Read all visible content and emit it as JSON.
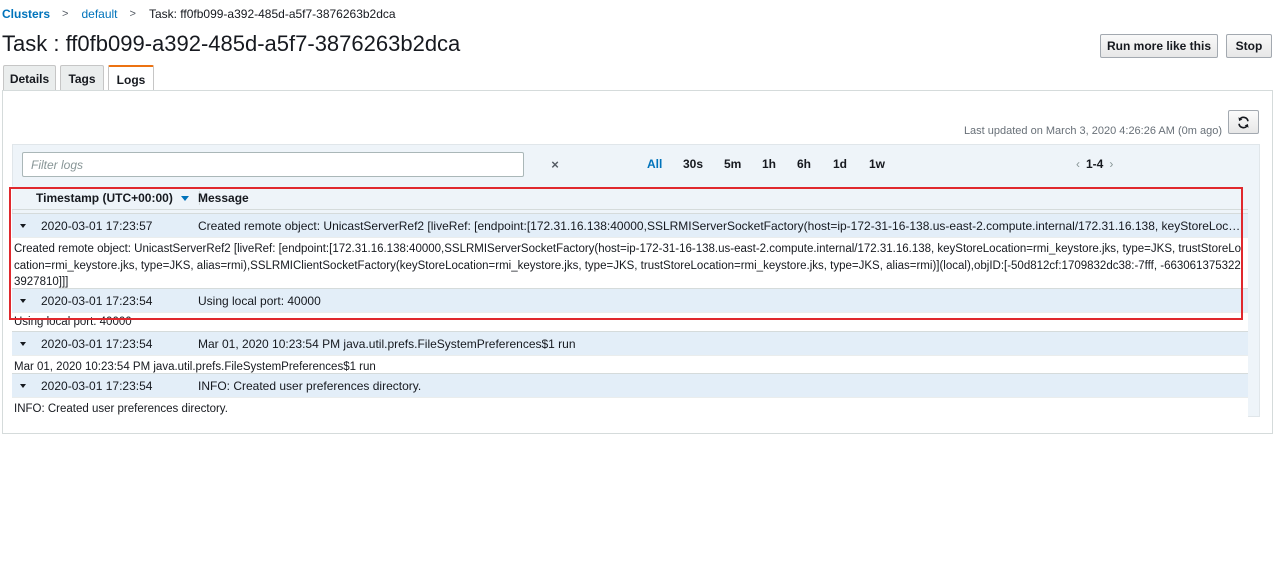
{
  "breadcrumb": {
    "items": [
      "Clusters",
      "default"
    ],
    "current": "Task: ff0fb099-a392-485d-a5f7-3876263b2dca",
    "separator": ">"
  },
  "page": {
    "title": "Task : ff0fb099-a392-485d-a5f7-3876263b2dca"
  },
  "header_buttons": {
    "run_more": "Run more like this",
    "stop": "Stop"
  },
  "tabs": [
    {
      "label": "Details",
      "active": false
    },
    {
      "label": "Tags",
      "active": false
    },
    {
      "label": "Logs",
      "active": true
    }
  ],
  "logs": {
    "last_updated": "Last updated on March 3, 2020 4:26:26 AM (0m ago)",
    "refresh_icon": "refresh-icon",
    "filter_placeholder": "Filter logs",
    "filter_value": "",
    "clear_icon": "×",
    "time_ranges": [
      "All",
      "30s",
      "5m",
      "1h",
      "6h",
      "1d",
      "1w"
    ],
    "active_range": "All",
    "pagination": {
      "text": "1-4",
      "prev": "‹",
      "next": "›"
    },
    "columns": {
      "timestamp": "Timestamp (UTC+00:00)",
      "message": "Message"
    },
    "rows": [
      {
        "timestamp": "2020-03-01 17:23:57",
        "message": "Created remote object: UnicastServerRef2 [liveRef: [endpoint:[172.31.16.138:40000,SSLRMIServerSocketFactory(host=ip-172-31-16-138.us-east-2.compute.internal/172.31.16.138, keyStoreLocation=rmi_keystore.jks, type=JKS,",
        "detail": "Created remote object: UnicastServerRef2 [liveRef: [endpoint:[172.31.16.138:40000,SSLRMIServerSocketFactory(host=ip-172-31-16-138.us-east-2.compute.internal/172.31.16.138, keyStoreLocation=rmi_keystore.jks, type=JKS, trustStoreLocation=rmi_keystore.jks, type=JKS, alias=rmi),SSLRMIClientSocketFactory(keyStoreLocation=rmi_keystore.jks, type=JKS, trustStoreLocation=rmi_keystore.jks, type=JKS, alias=rmi)](local),objID:[-50d812cf:1709832dc38:-7fff, -6630613753223927810]]]"
      },
      {
        "timestamp": "2020-03-01 17:23:54",
        "message": "Using local port: 40000",
        "detail": "Using local port: 40000"
      },
      {
        "timestamp": "2020-03-01 17:23:54",
        "message": "Mar 01, 2020 10:23:54 PM java.util.prefs.FileSystemPreferences$1 run",
        "detail": "Mar 01, 2020 10:23:54 PM java.util.prefs.FileSystemPreferences$1 run"
      },
      {
        "timestamp": "2020-03-01 17:23:54",
        "message": "INFO: Created user preferences directory.",
        "detail": "INFO: Created user preferences directory."
      }
    ]
  },
  "colors": {
    "link": "#0073bb",
    "active_tab_accent": "#ec7211",
    "highlight_box": "#e0282d",
    "row_summary_bg": "#e3eef8"
  }
}
